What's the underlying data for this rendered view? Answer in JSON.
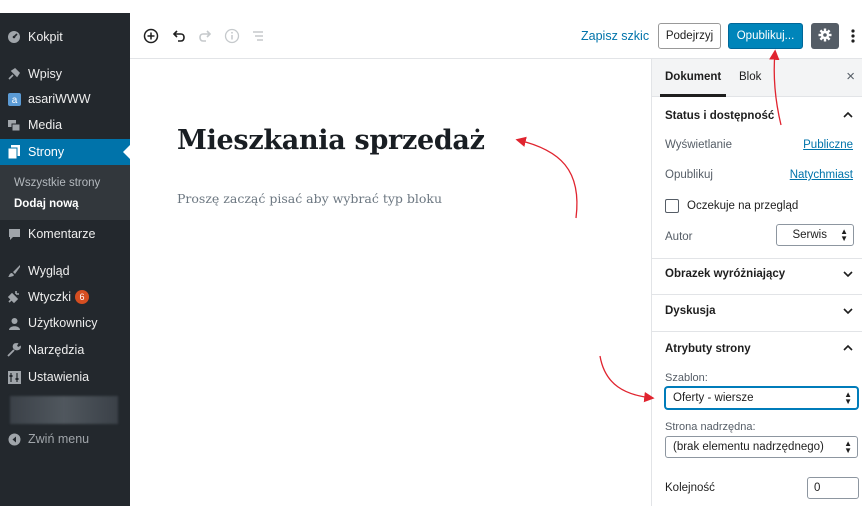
{
  "admin_menu": {
    "dashboard": "Kokpit",
    "posts": "Wpisy",
    "asari": "asariWWW",
    "media": "Media",
    "pages": "Strony",
    "pages_all": "Wszystkie strony",
    "pages_add": "Dodaj nową",
    "comments": "Komentarze",
    "appearance": "Wygląd",
    "plugins": "Wtyczki",
    "plugins_badge": "6",
    "users": "Użytkownicy",
    "tools": "Narzędzia",
    "settings": "Ustawienia",
    "collapse": "Zwiń menu"
  },
  "toolbar": {
    "save_draft": "Zapisz szkic",
    "preview": "Podejrzyj",
    "publish": "Opublikuj..."
  },
  "editor": {
    "title": "Mieszkania sprzedaż",
    "placeholder": "Proszę zacząć pisać aby wybrać typ bloku"
  },
  "settings_sidebar": {
    "tab_document": "Dokument",
    "tab_block": "Blok",
    "close": "×",
    "status_panel": {
      "title": "Status i dostępność",
      "visibility_label": "Wyświetlanie",
      "visibility_value": "Publiczne",
      "publish_label": "Opublikuj",
      "publish_value": "Natychmiast",
      "pending_label": "Oczekuje na przegląd",
      "author_label": "Autor",
      "author_value": "Serwis"
    },
    "featured_image_panel": {
      "title": "Obrazek wyróżniający"
    },
    "discussion_panel": {
      "title": "Dyskusja"
    },
    "page_attributes_panel": {
      "title": "Atrybuty strony",
      "template_label": "Szablon:",
      "template_value": "Oferty - wiersze",
      "parent_label": "Strona nadrzędna:",
      "parent_value": "(brak elementu nadrzędnego)",
      "order_label": "Kolejność",
      "order_value": "0"
    }
  },
  "colors": {
    "admin_bg": "#23282d",
    "active_blue": "#0073aa",
    "publish_blue": "#0085ba",
    "annotation_red": "#e0242f",
    "badge": "#d54e21"
  }
}
